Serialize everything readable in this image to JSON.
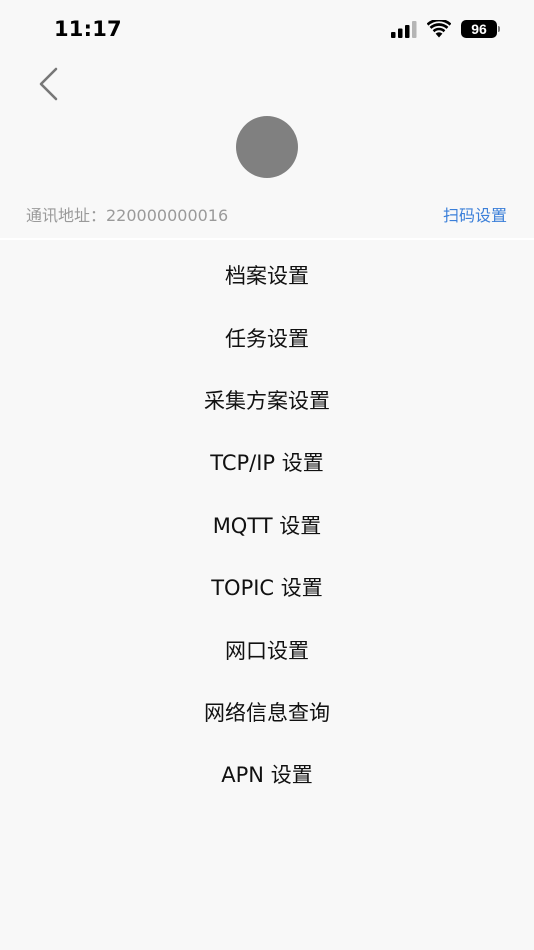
{
  "status_bar": {
    "time": "11:17",
    "battery": "96",
    "icons": [
      "signal-icon",
      "wifi-icon",
      "battery-icon"
    ]
  },
  "header": {
    "back_icon": "chevron-left-icon",
    "address_text": "通讯地址：220000000016",
    "scan_label": "扫码设置"
  },
  "menu": {
    "items": [
      {
        "label": "档案设置"
      },
      {
        "label": "任务设置"
      },
      {
        "label": "采集方案设置"
      },
      {
        "label": "TCP/IP 设置"
      },
      {
        "label": "MQTT 设置"
      },
      {
        "label": "TOPIC 设置"
      },
      {
        "label": "网口设置"
      },
      {
        "label": "网络信息查询"
      },
      {
        "label": "APN 设置"
      }
    ]
  },
  "colors": {
    "background": "#f8f8f8",
    "avatar": "#808080",
    "link": "#3b7fd9",
    "muted_text": "#9a9a9a"
  }
}
